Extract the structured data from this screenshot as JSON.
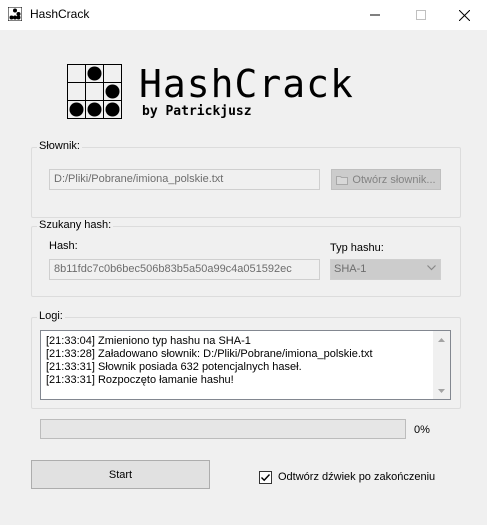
{
  "window": {
    "title": "HashCrack",
    "controls": [
      "minimize-icon",
      "maximize-icon",
      "close-icon"
    ]
  },
  "logo": {
    "title": "HashCrack",
    "subtitle": "by Patrickjusz"
  },
  "dictionary_group": {
    "label": "Słownik:",
    "path_value": "D:/Pliki/Pobrane/imiona_polskie.txt",
    "open_button_label": "Otwórz słownik..."
  },
  "hash_group": {
    "label": "Szukany hash:",
    "hash_label": "Hash:",
    "hash_value": "8b11fdc7c0b6bec506b83b5a50a99c4a051592ec",
    "type_label": "Typ hashu:",
    "type_value": "SHA-1"
  },
  "log_group": {
    "label": "Logi:",
    "lines": [
      "[21:33:04] Zmieniono typ hashu na SHA-1",
      "[21:33:28] Załadowano słownik: D:/Pliki/Pobrane/imiona_polskie.txt",
      "[21:33:31] Słownik posiada 632 potencjalnych haseł.",
      "[21:33:31] Rozpoczęto łamanie hashu!"
    ]
  },
  "progress": {
    "value": 0,
    "label": "0%"
  },
  "start_button_label": "Start",
  "sound_checkbox": {
    "label": "Odtwórz dźwiek po zakończeniu",
    "checked": true
  },
  "colors": {
    "window_bg": "#f0f0f0",
    "titlebar_bg": "#ffffff",
    "disabled_button_bg": "#cccccc",
    "progress_fill": "#06b025"
  }
}
